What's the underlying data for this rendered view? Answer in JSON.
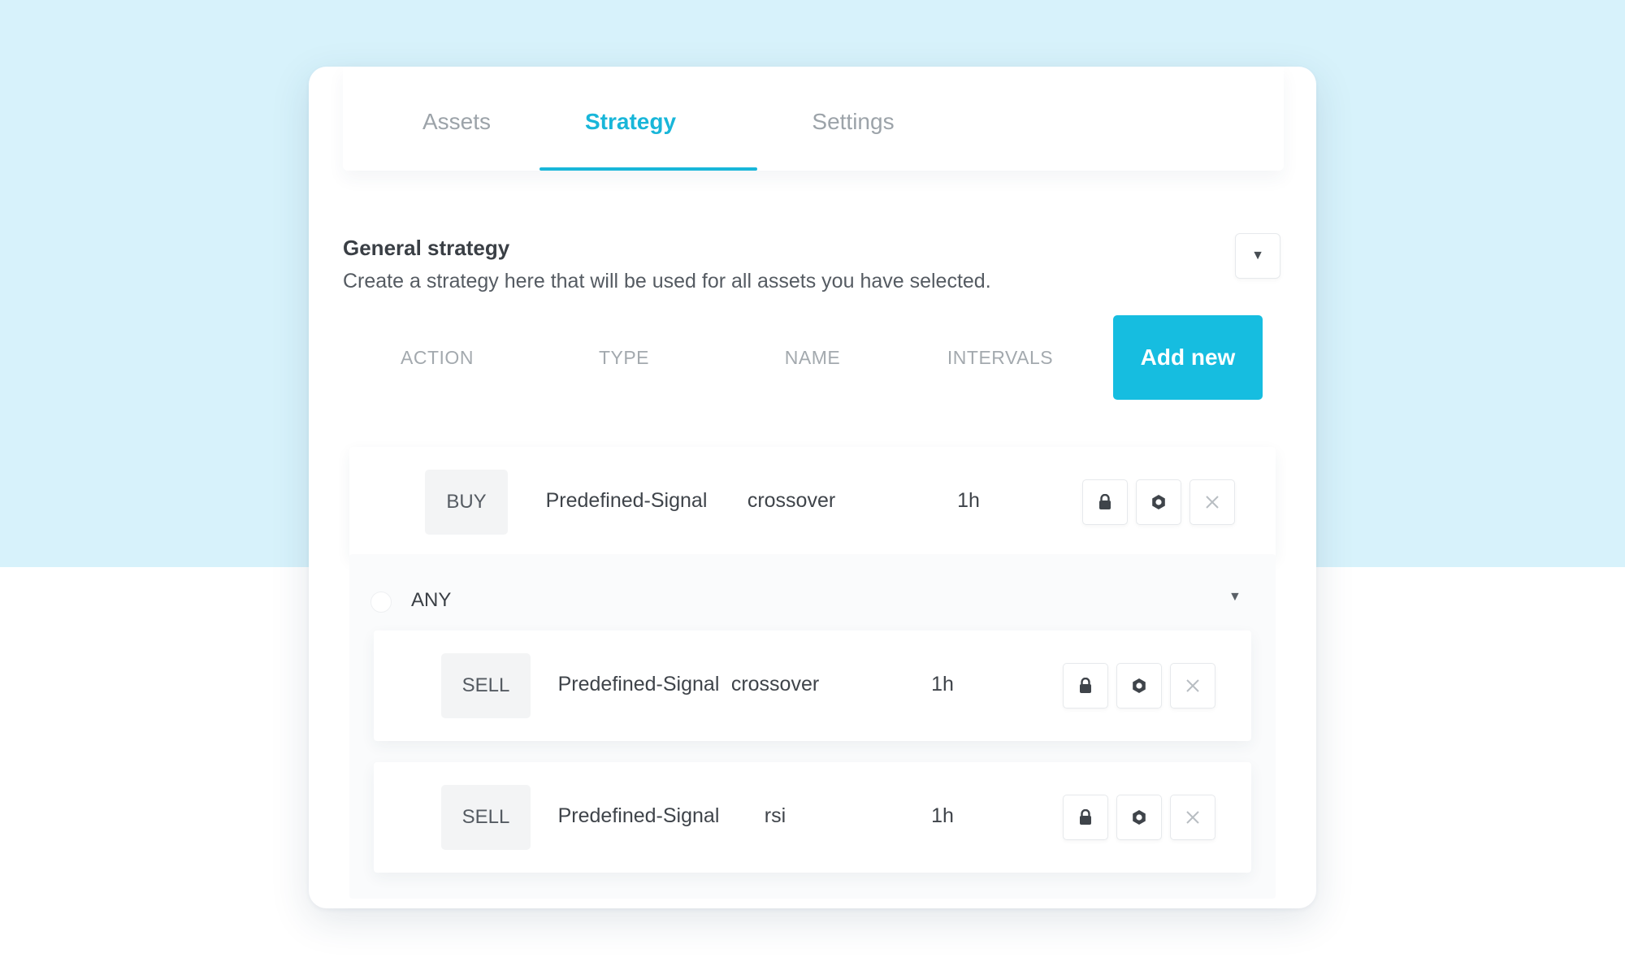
{
  "tabs": [
    {
      "label": "Assets"
    },
    {
      "label": "Strategy"
    },
    {
      "label": "Settings"
    }
  ],
  "active_tab": "Strategy",
  "section": {
    "title": "General strategy",
    "description": "Create a strategy here that will be used for all assets you have selected."
  },
  "columns": {
    "action": "ACTION",
    "type": "TYPE",
    "name": "NAME",
    "intervals": "INTERVALS"
  },
  "add_button": "Add new",
  "rows": [
    {
      "action": "BUY",
      "type": "Predefined-Signal",
      "name": "crossover",
      "interval": "1h"
    }
  ],
  "group": {
    "label": "ANY",
    "rows": [
      {
        "action": "SELL",
        "type": "Predefined-Signal",
        "name": "crossover",
        "interval": "1h"
      },
      {
        "action": "SELL",
        "type": "Predefined-Signal",
        "name": "rsi",
        "interval": "1h"
      }
    ]
  },
  "icons": {
    "collapse": "chevron-down-icon",
    "lock": "lock-icon",
    "settings": "settings-icon",
    "remove": "close-icon"
  },
  "colors": {
    "accent": "#18b6d9",
    "button": "#16bde0",
    "background_top": "#d7f2fb"
  }
}
